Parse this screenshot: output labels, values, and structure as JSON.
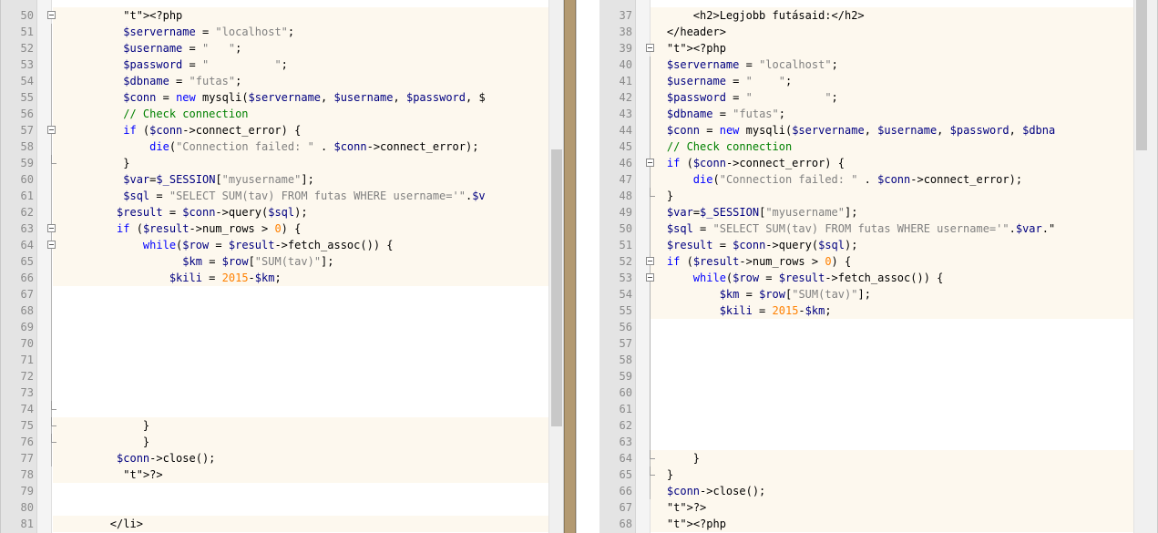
{
  "left_editor": {
    "lines": [
      {
        "num": "50",
        "indent": "          ",
        "text": "<?php"
      },
      {
        "num": "51",
        "indent": "          ",
        "text": "$servername = \"localhost\";"
      },
      {
        "num": "52",
        "indent": "          ",
        "text": "$username = \"   \";"
      },
      {
        "num": "53",
        "indent": "          ",
        "text": "$password = \"          \";"
      },
      {
        "num": "54",
        "indent": "          ",
        "text": "$dbname = \"futas\";"
      },
      {
        "num": "55",
        "indent": "          ",
        "text": "$conn = new mysqli($servername, $username, $password, $"
      },
      {
        "num": "56",
        "indent": "          ",
        "text": "// Check connection"
      },
      {
        "num": "57",
        "indent": "          ",
        "text": "if ($conn->connect_error) {"
      },
      {
        "num": "58",
        "indent": "              ",
        "text": "die(\"Connection failed: \" . $conn->connect_error);"
      },
      {
        "num": "59",
        "indent": "          ",
        "text": "}"
      },
      {
        "num": "60",
        "indent": "          ",
        "text": "$var=$_SESSION[\"myusername\"];"
      },
      {
        "num": "61",
        "indent": "          ",
        "text": "$sql = \"SELECT SUM(tav) FROM futas WHERE username='\".$v"
      },
      {
        "num": "62",
        "indent": "         ",
        "text": "$result = $conn->query($sql);"
      },
      {
        "num": "63",
        "indent": "         ",
        "text": "if ($result->num_rows > 0) {"
      },
      {
        "num": "64",
        "indent": "             ",
        "text": "while($row = $result->fetch_assoc()) {"
      },
      {
        "num": "65",
        "indent": "                   ",
        "text": "$km = $row[\"SUM(tav)\"];"
      },
      {
        "num": "66",
        "indent": "                 ",
        "text": "$kili = 2015-$km;"
      },
      {
        "num": "67",
        "indent": "",
        "text": ""
      },
      {
        "num": "68",
        "indent": "",
        "text": ""
      },
      {
        "num": "69",
        "indent": "",
        "text": ""
      },
      {
        "num": "70",
        "indent": "",
        "text": ""
      },
      {
        "num": "71",
        "indent": "",
        "text": ""
      },
      {
        "num": "72",
        "indent": "",
        "text": ""
      },
      {
        "num": "73",
        "indent": "",
        "text": ""
      },
      {
        "num": "74",
        "indent": "",
        "text": ""
      },
      {
        "num": "75",
        "indent": "             ",
        "text": "}"
      },
      {
        "num": "76",
        "indent": "             ",
        "text": "}"
      },
      {
        "num": "77",
        "indent": "         ",
        "text": "$conn->close();"
      },
      {
        "num": "78",
        "indent": "          ",
        "text": "?>"
      },
      {
        "num": "79",
        "indent": "",
        "text": ""
      },
      {
        "num": "80",
        "indent": "",
        "text": ""
      },
      {
        "num": "81",
        "indent": "        ",
        "text": "</li>"
      }
    ]
  },
  "right_editor": {
    "lines": [
      {
        "num": "37",
        "indent": "        ",
        "text": "<h2>Legjobb futásaid:</h2>"
      },
      {
        "num": "38",
        "indent": "    ",
        "text": "</header>"
      },
      {
        "num": "39",
        "indent": "    ",
        "text": "<?php"
      },
      {
        "num": "40",
        "indent": "    ",
        "text": "$servername = \"localhost\";"
      },
      {
        "num": "41",
        "indent": "    ",
        "text": "$username = \"    \";"
      },
      {
        "num": "42",
        "indent": "    ",
        "text": "$password = \"           \";"
      },
      {
        "num": "43",
        "indent": "    ",
        "text": "$dbname = \"futas\";"
      },
      {
        "num": "44",
        "indent": "    ",
        "text": "$conn = new mysqli($servername, $username, $password, $dbna"
      },
      {
        "num": "45",
        "indent": "    ",
        "text": "// Check connection"
      },
      {
        "num": "46",
        "indent": "    ",
        "text": "if ($conn->connect_error) {"
      },
      {
        "num": "47",
        "indent": "        ",
        "text": "die(\"Connection failed: \" . $conn->connect_error);"
      },
      {
        "num": "48",
        "indent": "    ",
        "text": "}"
      },
      {
        "num": "49",
        "indent": "    ",
        "text": "$var=$_SESSION[\"myusername\"];"
      },
      {
        "num": "50",
        "indent": "    ",
        "text": "$sql = \"SELECT SUM(tav) FROM futas WHERE username='\".$var.\""
      },
      {
        "num": "51",
        "indent": "    ",
        "text": "$result = $conn->query($sql);"
      },
      {
        "num": "52",
        "indent": "    ",
        "text": "if ($result->num_rows > 0) {"
      },
      {
        "num": "53",
        "indent": "        ",
        "text": "while($row = $result->fetch_assoc()) {"
      },
      {
        "num": "54",
        "indent": "            ",
        "text": "$km = $row[\"SUM(tav)\"];"
      },
      {
        "num": "55",
        "indent": "            ",
        "text": "$kili = 2015-$km;"
      },
      {
        "num": "56",
        "indent": "",
        "text": ""
      },
      {
        "num": "57",
        "indent": "",
        "text": ""
      },
      {
        "num": "58",
        "indent": "",
        "text": ""
      },
      {
        "num": "59",
        "indent": "",
        "text": ""
      },
      {
        "num": "60",
        "indent": "",
        "text": ""
      },
      {
        "num": "61",
        "indent": "",
        "text": ""
      },
      {
        "num": "62",
        "indent": "",
        "text": ""
      },
      {
        "num": "63",
        "indent": "",
        "text": ""
      },
      {
        "num": "64",
        "indent": "        ",
        "text": "}"
      },
      {
        "num": "65",
        "indent": "    ",
        "text": "}"
      },
      {
        "num": "66",
        "indent": "    ",
        "text": "$conn->close();"
      },
      {
        "num": "67",
        "indent": "    ",
        "text": "?>"
      },
      {
        "num": "68",
        "indent": "    ",
        "text": "<?php"
      }
    ]
  }
}
